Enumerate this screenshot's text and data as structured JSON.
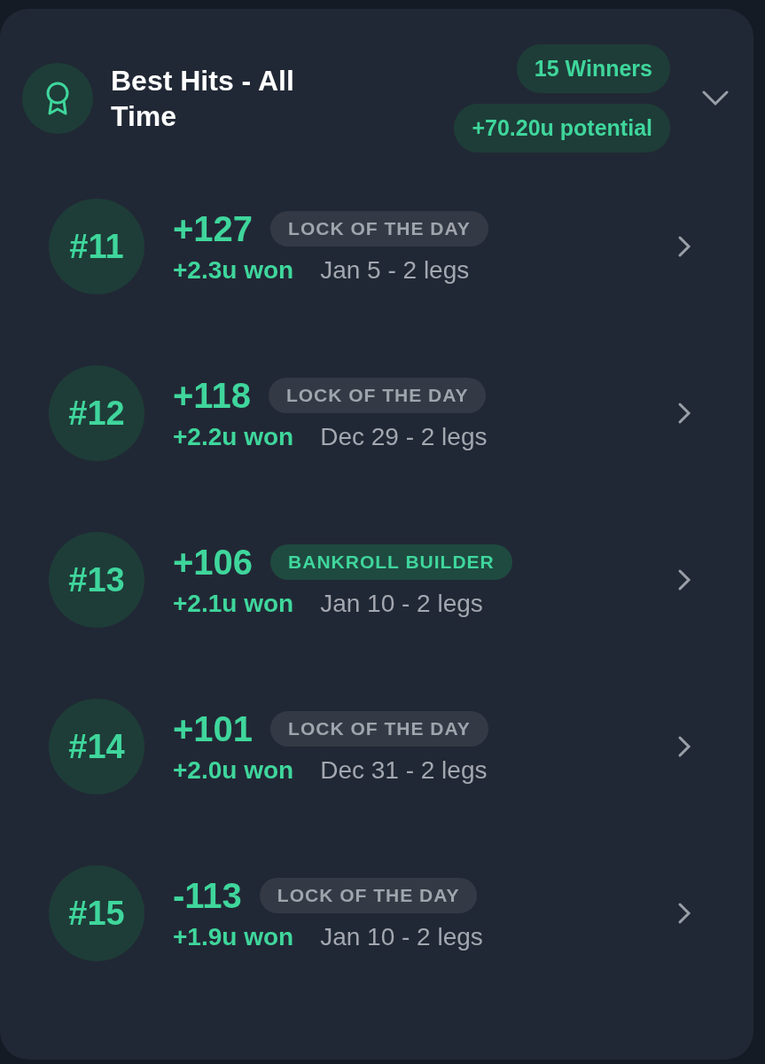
{
  "header": {
    "title": "Best Hits - All Time",
    "badges": [
      "15 Winners",
      "+70.20u potential"
    ],
    "expanded": true
  },
  "hits": [
    {
      "rank": "#11",
      "odds": "+127",
      "tag": {
        "label": "LOCK OF THE DAY",
        "kind": "neutral"
      },
      "won": "+2.3u won",
      "detail": "Jan 5 - 2 legs"
    },
    {
      "rank": "#12",
      "odds": "+118",
      "tag": {
        "label": "LOCK OF THE DAY",
        "kind": "neutral"
      },
      "won": "+2.2u won",
      "detail": "Dec 29 - 2 legs"
    },
    {
      "rank": "#13",
      "odds": "+106",
      "tag": {
        "label": "BANKROLL BUILDER",
        "kind": "highlight"
      },
      "won": "+2.1u won",
      "detail": "Jan 10 - 2 legs"
    },
    {
      "rank": "#14",
      "odds": "+101",
      "tag": {
        "label": "LOCK OF THE DAY",
        "kind": "neutral"
      },
      "won": "+2.0u won",
      "detail": "Dec 31 - 2 legs"
    },
    {
      "rank": "#15",
      "odds": "-113",
      "tag": {
        "label": "LOCK OF THE DAY",
        "kind": "neutral"
      },
      "won": "+1.9u won",
      "detail": "Jan 10 - 2 legs"
    }
  ]
}
